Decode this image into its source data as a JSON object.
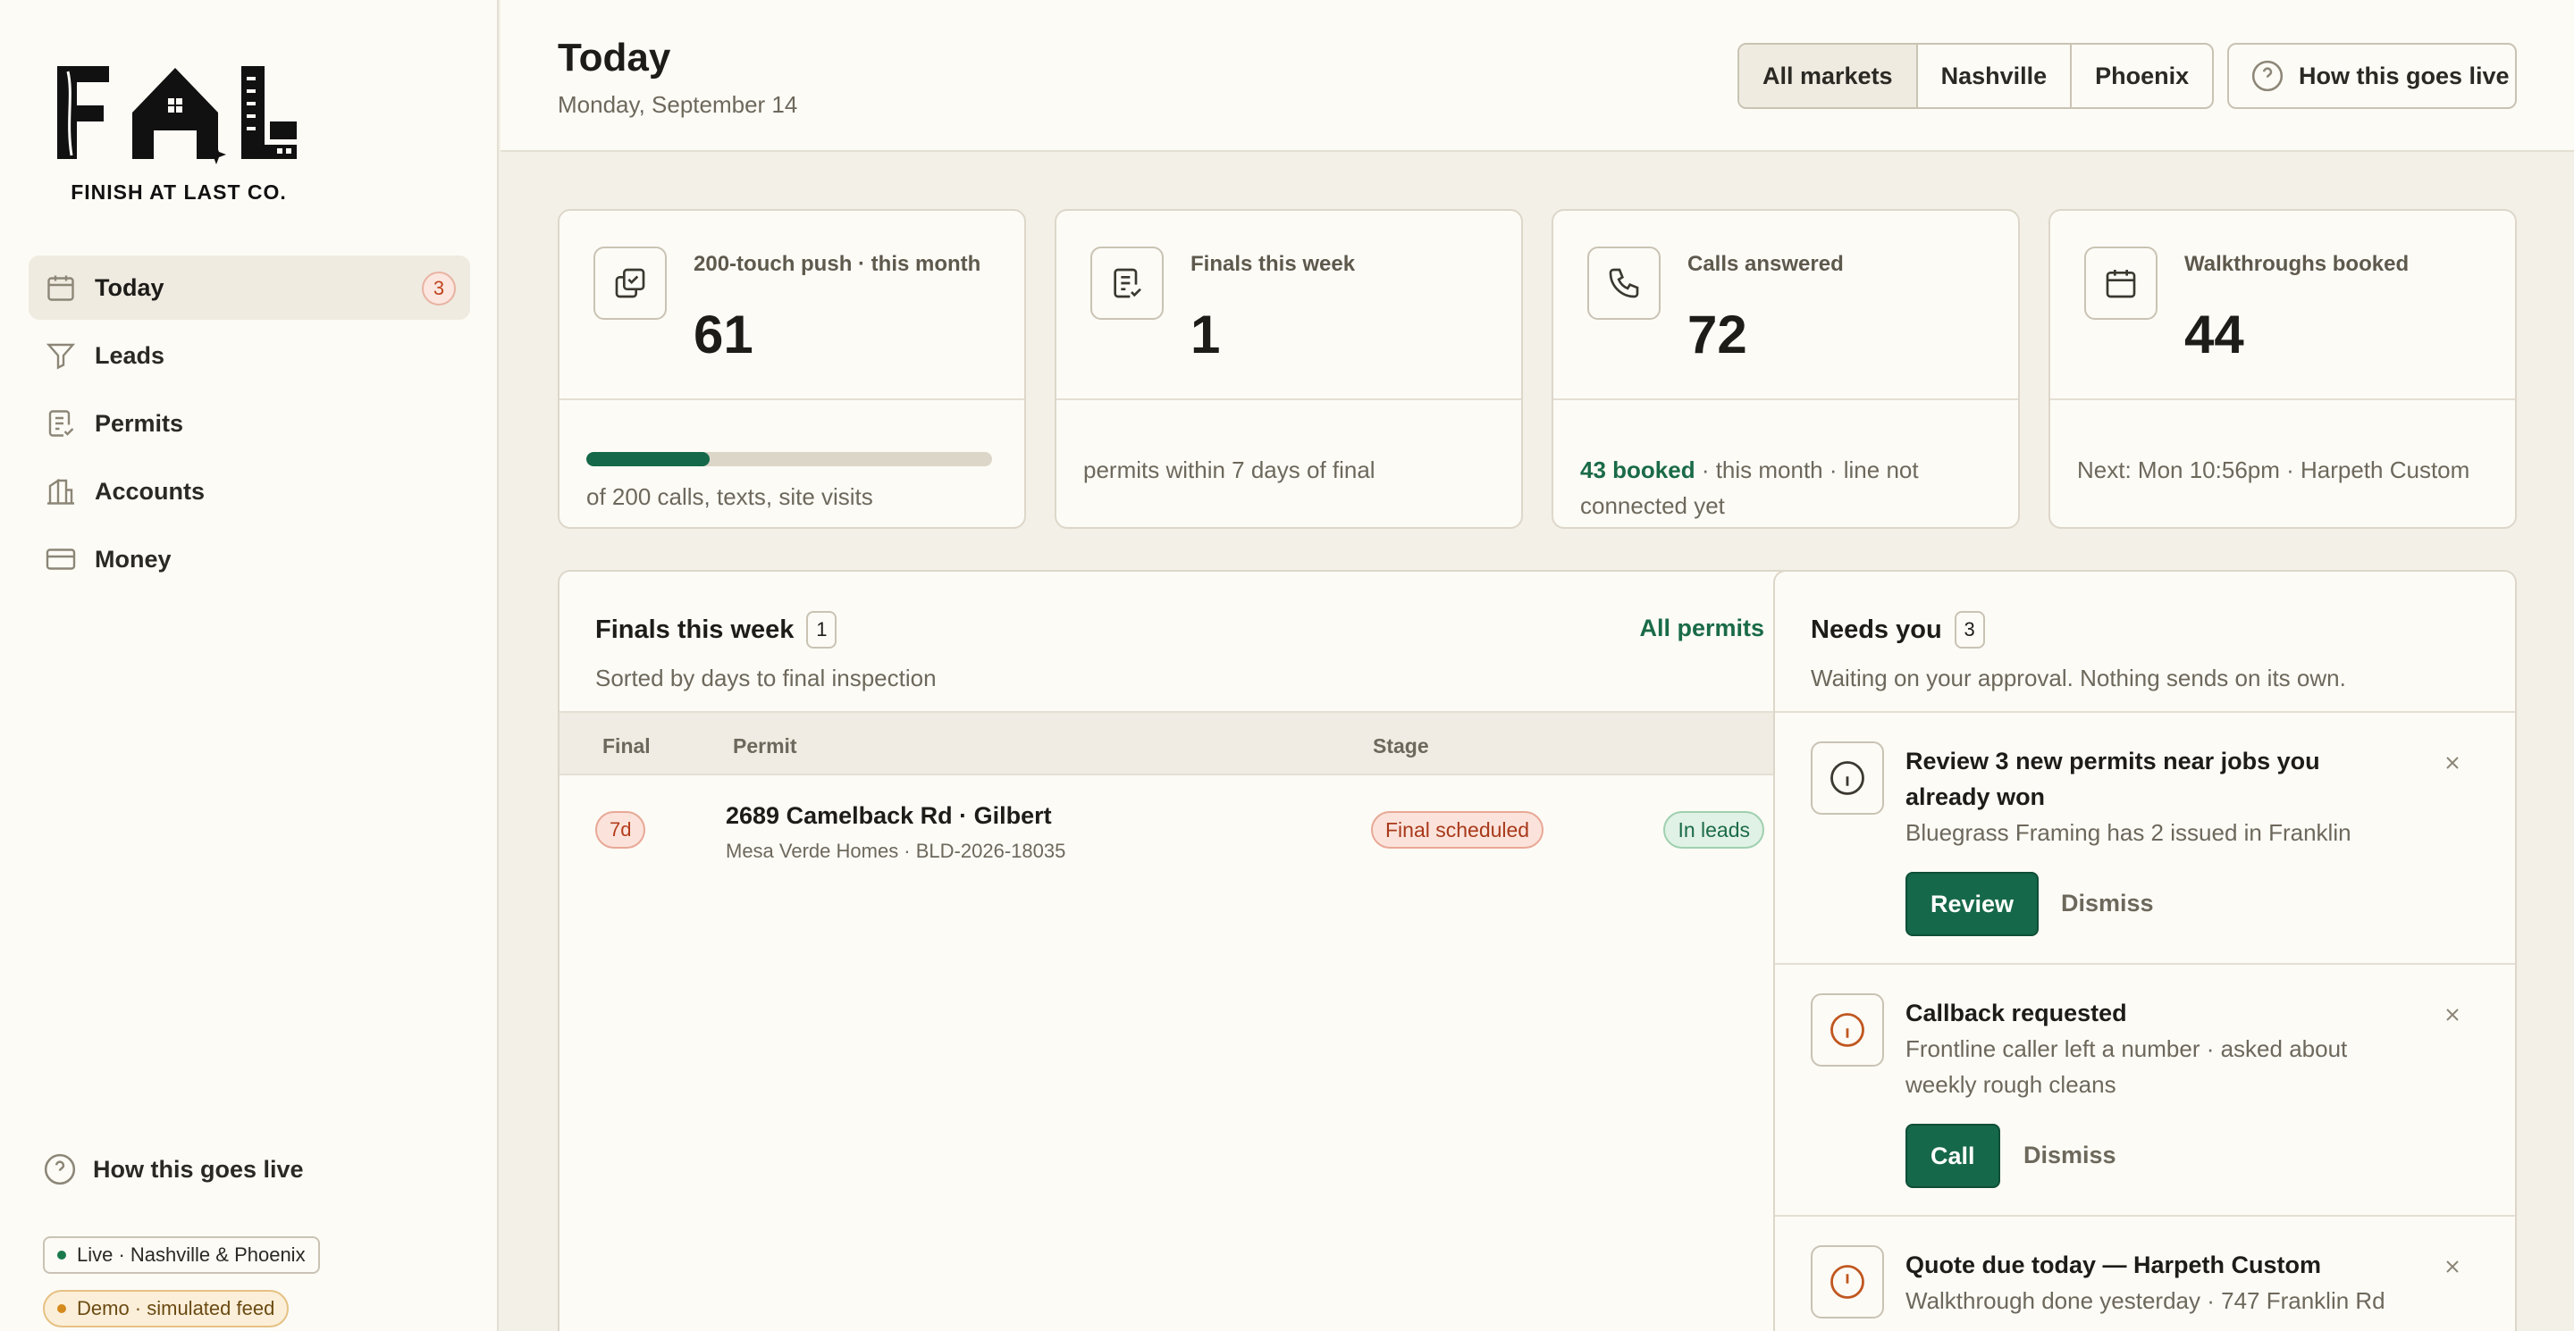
{
  "brand": {
    "logo_text": "FINISH AT LAST CO."
  },
  "sidebar": {
    "items": [
      {
        "label": "Today",
        "badge": "3"
      },
      {
        "label": "Leads"
      },
      {
        "label": "Permits"
      },
      {
        "label": "Accounts"
      },
      {
        "label": "Money"
      }
    ],
    "help_label": "How this goes live",
    "status_live": "Live · Nashville & Phoenix",
    "status_demo": "Demo · simulated feed"
  },
  "header": {
    "title": "Today",
    "date": "Monday, September 14",
    "markets": [
      "All markets",
      "Nashville",
      "Phoenix"
    ],
    "selected_market": "All markets",
    "help_button": "How this goes live"
  },
  "stats": [
    {
      "icon": "checklist-copy-icon",
      "label": "200-touch push · this month",
      "value": "61",
      "progress": 0.305,
      "footer": "of 200 calls, texts, site visits"
    },
    {
      "icon": "document-check-icon",
      "label": "Finals this week",
      "value": "1",
      "footer": "permits within 7 days of final"
    },
    {
      "icon": "phone-icon",
      "label": "Calls answered",
      "value": "72",
      "footer_strong": "43 booked",
      "footer": " · this month · line not connected yet"
    },
    {
      "icon": "calendar-icon",
      "label": "Walkthroughs booked",
      "value": "44",
      "footer": "Next: Mon 10:56pm · Harpeth Custom"
    }
  ],
  "finals": {
    "title": "Finals this week",
    "count": "1",
    "subtitle": "Sorted by days to final inspection",
    "link": "All permits",
    "columns": [
      "Final",
      "Permit",
      "Stage"
    ],
    "rows": [
      {
        "days": "7d",
        "address": "2689 Camelback Rd · Gilbert",
        "meta": "Mesa Verde Homes · BLD-2026-18035",
        "stage": "Final scheduled",
        "status": "In leads"
      }
    ]
  },
  "needs": {
    "title": "Needs you",
    "count": "3",
    "subtitle": "Waiting on your approval. Nothing sends on its own.",
    "cards": [
      {
        "title": "Review 3 new permits near jobs you already won",
        "subtitle": "Bluegrass Framing has 2 issued in Franklin",
        "primary": "Review",
        "secondary": "Dismiss"
      },
      {
        "title": "Callback requested",
        "subtitle": "Frontline caller left a number · asked about weekly rough cleans",
        "primary": "Call",
        "secondary": "Dismiss"
      },
      {
        "title": "Quote due today — Harpeth Custom",
        "subtitle": "Walkthrough done yesterday · 747 Franklin Rd"
      }
    ]
  },
  "colors": {
    "accent": "#16684a",
    "warn": "#c0571f",
    "bg": "#f3f0e8"
  }
}
